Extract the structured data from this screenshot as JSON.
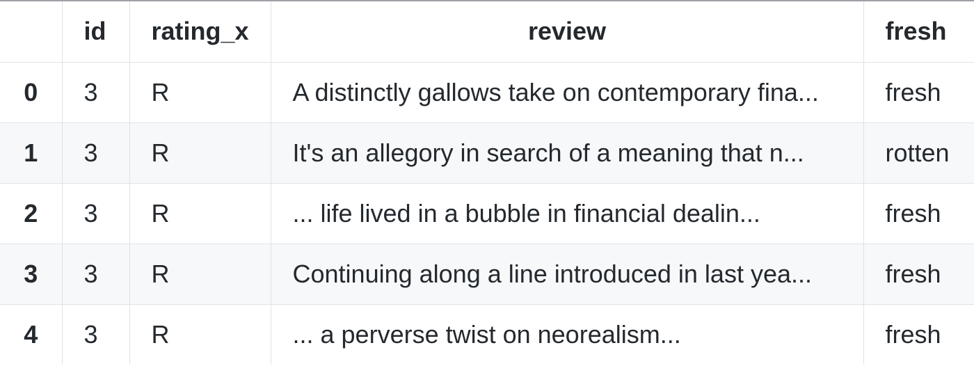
{
  "table": {
    "columns": [
      "",
      "id",
      "rating_x",
      "review",
      "fresh"
    ],
    "rows": [
      {
        "index": "0",
        "id": "3",
        "rating_x": "R",
        "review": "A distinctly gallows take on contemporary fina...",
        "fresh": "fresh"
      },
      {
        "index": "1",
        "id": "3",
        "rating_x": "R",
        "review": "It's an allegory in search of a meaning that n...",
        "fresh": "rotten"
      },
      {
        "index": "2",
        "id": "3",
        "rating_x": "R",
        "review": "... life lived in a bubble in financial dealin...",
        "fresh": "fresh"
      },
      {
        "index": "3",
        "id": "3",
        "rating_x": "R",
        "review": "Continuing along a line introduced in last yea...",
        "fresh": "fresh"
      },
      {
        "index": "4",
        "id": "3",
        "rating_x": "R",
        "review": "... a perverse twist on neorealism...",
        "fresh": "fresh"
      }
    ]
  }
}
